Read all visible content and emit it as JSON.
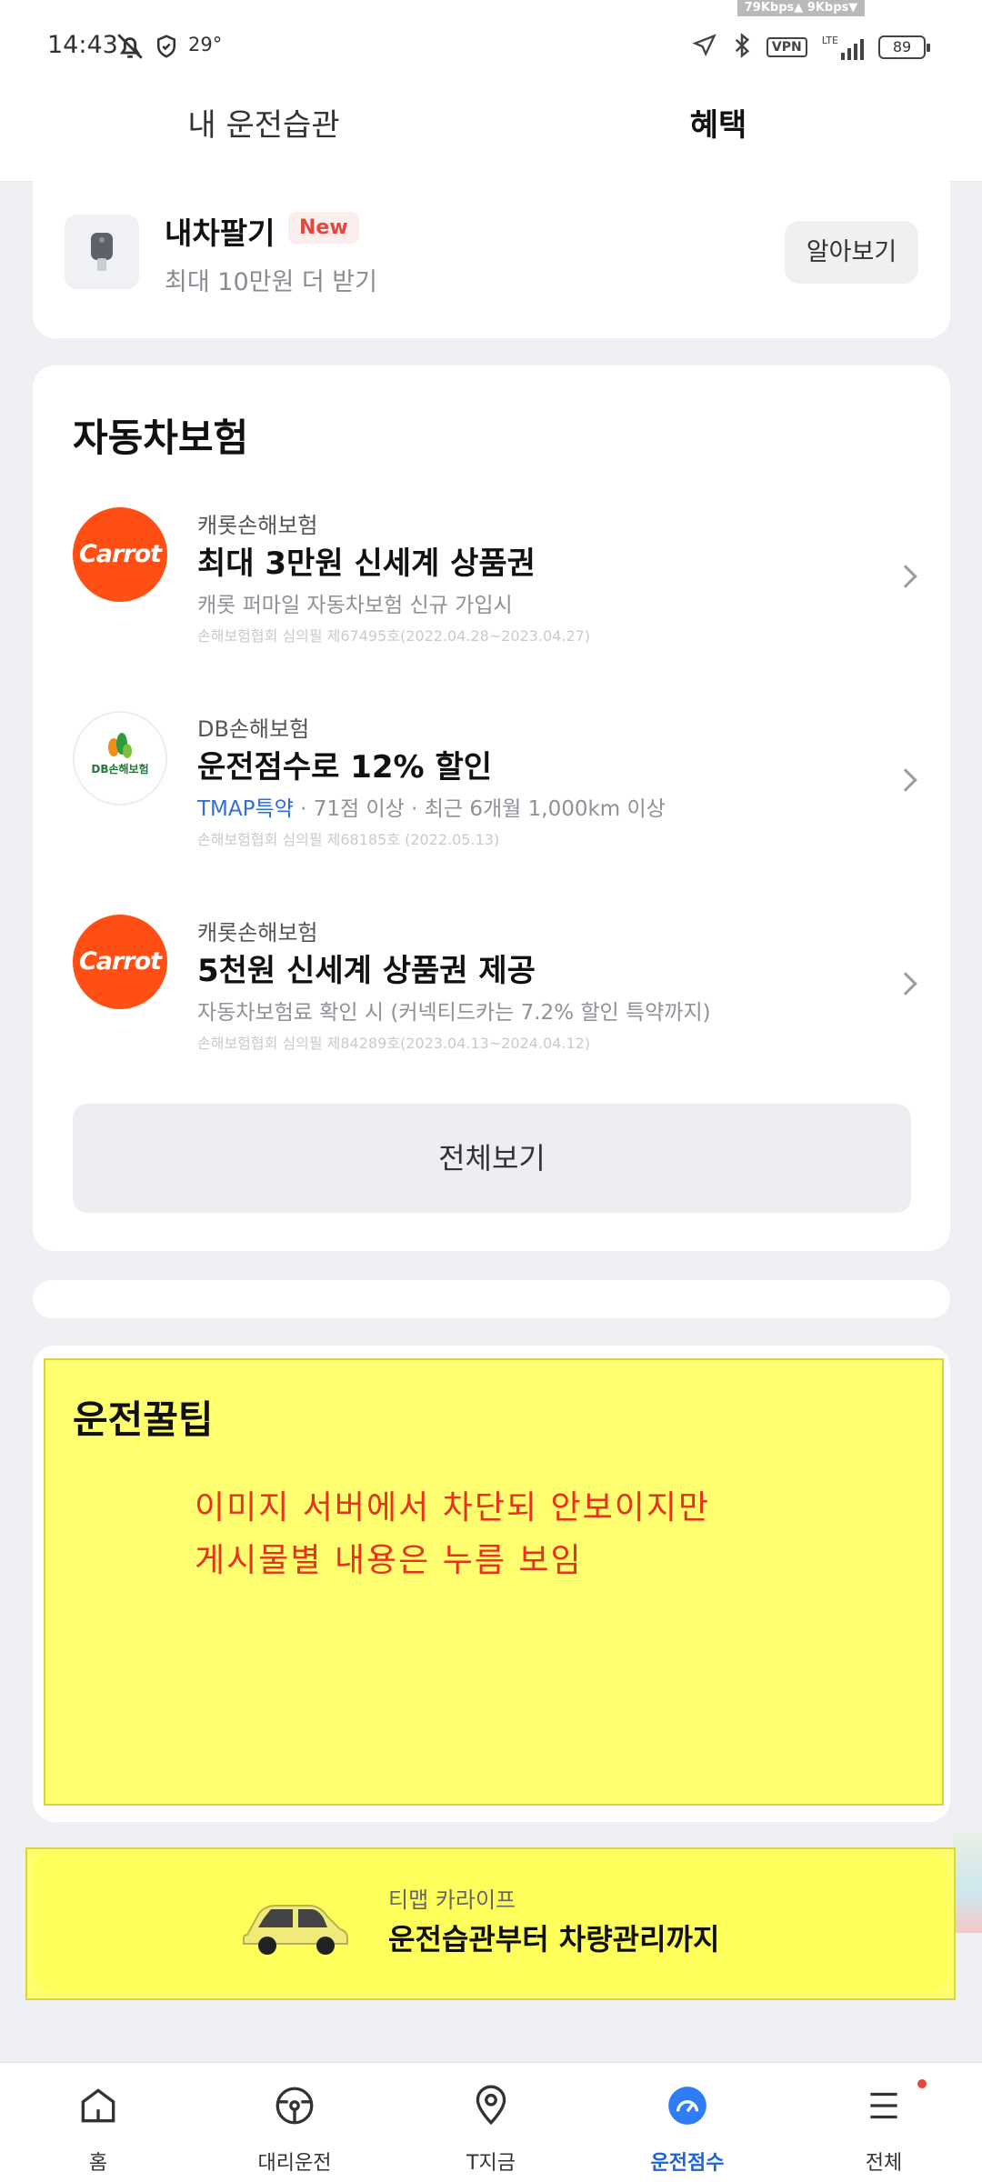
{
  "status_bar": {
    "time": "14:43",
    "temperature": "29°",
    "net_speed": "79Kbps▲ 9Kbps▼",
    "network_label": "LTE",
    "vpn_label": "VPN",
    "battery": "89"
  },
  "tabs": [
    {
      "label": "내 운전습관",
      "selected": false
    },
    {
      "label": "혜택",
      "selected": true
    }
  ],
  "sell_car": {
    "title": "내차팔기",
    "badge": "New",
    "subtitle": "최대 10만원 더 받기",
    "button": "알아보기"
  },
  "insurance": {
    "section_title": "자동차보험",
    "items": [
      {
        "logo_text": "Carrot",
        "company": "캐롯손해보험",
        "headline": "최대 3만원 신세계 상품권",
        "description": "캐롯 퍼마일 자동차보험 신규 가입시",
        "description_prefix": "",
        "legal": "손해보험협회 심의필 제67495호(2022.04.28~2023.04.27)"
      },
      {
        "logo_text": "DB손해보험",
        "company": "DB손해보험",
        "headline": "운전점수로 12% 할인",
        "description_prefix": "TMAP특약",
        "description": " · 71점 이상 · 최근 6개월 1,000km 이상",
        "legal": "손해보험협회 심의필 제68185호 (2022.05.13)"
      },
      {
        "logo_text": "Carrot",
        "company": "캐롯손해보험",
        "headline": "5천원 신세계 상품권 제공",
        "description": "자동차보험료 확인 시 (커넥티드카는 7.2% 할인 특약까지)",
        "description_prefix": "",
        "legal": "손해보험협회 심의필 제84289호(2023.04.13~2024.04.12)"
      }
    ],
    "view_all": "전체보기"
  },
  "tips": {
    "title": "운전꿀팁",
    "note_line1": "이미지 서버에서 차단되 안보이지만",
    "note_line2": "게시물별 내용은 누름 보임"
  },
  "promo": {
    "subtitle": "티맵 카라이프",
    "title": "운전습관부터 차량관리까지",
    "car_color": "#f4ef8a"
  },
  "bottom_nav": [
    {
      "label": "홈",
      "icon": "home-icon",
      "active": false
    },
    {
      "label": "대리운전",
      "icon": "steering-wheel-icon",
      "active": false
    },
    {
      "label": "T지금",
      "icon": "location-pin-icon",
      "active": false
    },
    {
      "label": "운전점수",
      "icon": "driving-score-icon",
      "active": true
    },
    {
      "label": "전체",
      "icon": "menu-icon",
      "active": false
    }
  ],
  "colors": {
    "accent_blue": "#1e64d8",
    "carrot_orange": "#ff4f14",
    "badge_red": "#e8453c",
    "highlight_yellow": "#ffff70"
  }
}
